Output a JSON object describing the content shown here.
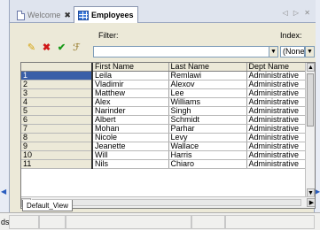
{
  "tabs": [
    {
      "label": "Welcome",
      "active": false,
      "close": "✖"
    },
    {
      "label": "Employees",
      "active": true
    }
  ],
  "nav_arrows": "◁ ▷ ✕",
  "filter": {
    "label": "Filter:",
    "value": "",
    "index_label": "Index:",
    "index_value": "(None)"
  },
  "toolbar_icons": [
    "add-record-icon",
    "delete-record-icon",
    "save-record-icon",
    "filter-icon"
  ],
  "grid": {
    "columns": [
      "",
      "First Name",
      "Last Name",
      "Dept Name"
    ],
    "rows": [
      {
        "num": "1",
        "first": "Leila",
        "last": "Remlawi",
        "dept": "Administrative",
        "selected": true
      },
      {
        "num": "2",
        "first": "Vladimir",
        "last": "Alexov",
        "dept": "Administrative"
      },
      {
        "num": "3",
        "first": "Matthew",
        "last": "Lee",
        "dept": "Administrative"
      },
      {
        "num": "4",
        "first": "Alex",
        "last": "Williams",
        "dept": "Administrative"
      },
      {
        "num": "5",
        "first": "Narinder",
        "last": "Singh",
        "dept": "Administrative"
      },
      {
        "num": "6",
        "first": "Albert",
        "last": "Schmidt",
        "dept": "Administrative"
      },
      {
        "num": "7",
        "first": "Mohan",
        "last": "Parhar",
        "dept": "Administrative"
      },
      {
        "num": "8",
        "first": "Nicole",
        "last": "Levy",
        "dept": "Administrative"
      },
      {
        "num": "9",
        "first": "Jeanette",
        "last": "Wallace",
        "dept": "Administrative"
      },
      {
        "num": "10",
        "first": "Will",
        "last": "Harris",
        "dept": "Administrative"
      },
      {
        "num": "11",
        "first": "Nils",
        "last": "Chiaro",
        "dept": "Administrative"
      }
    ]
  },
  "view_tab": "Default_View",
  "status": {
    "text": "ds"
  },
  "colors": {
    "selected_row": "#3a5fa8",
    "tab_strip": "#dfe4ee"
  }
}
